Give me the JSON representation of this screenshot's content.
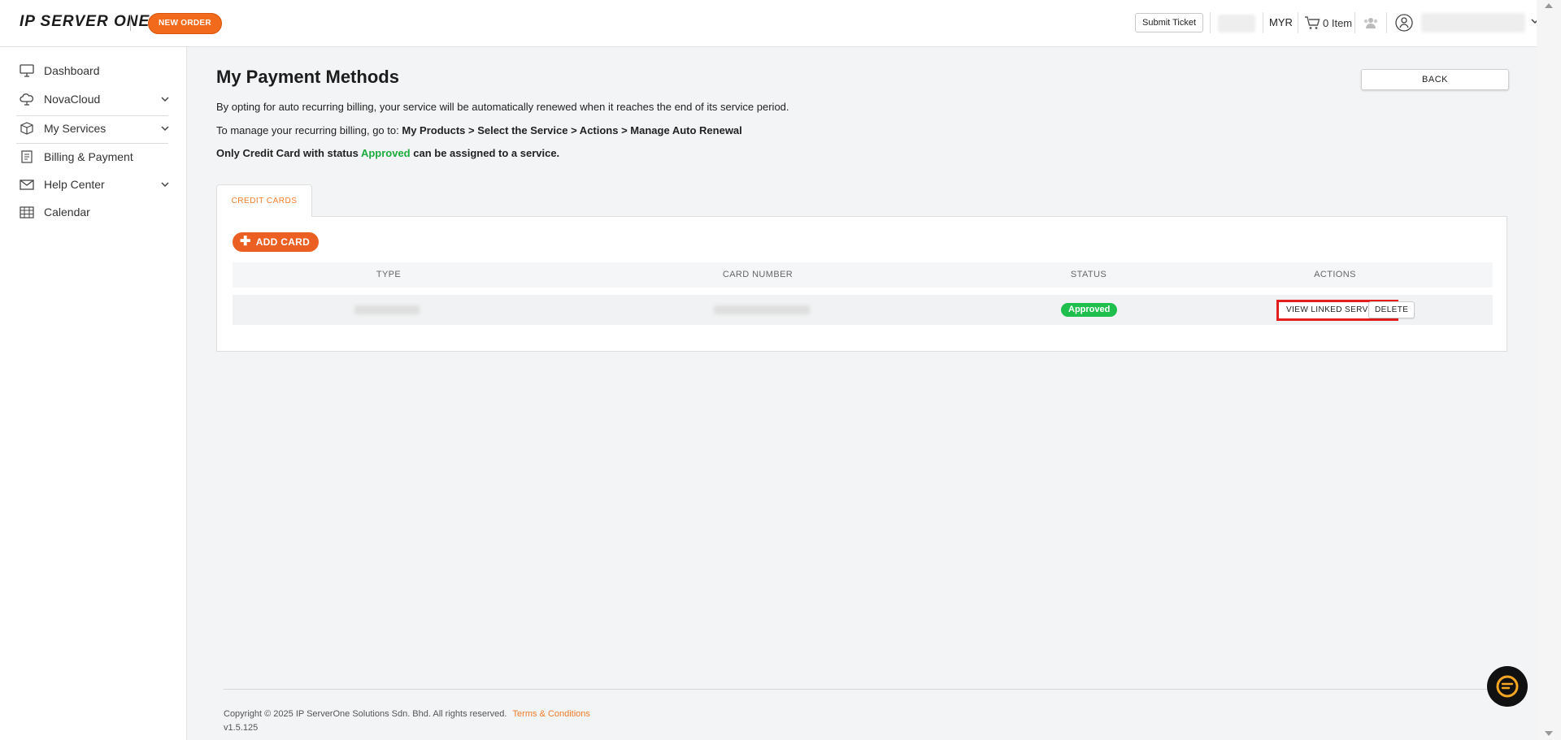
{
  "header": {
    "logo_text": "IP SERVER ONE",
    "new_order_label": "NEW ORDER",
    "submit_ticket_label": "Submit Ticket",
    "currency": "MYR",
    "cart_label": "0 Item"
  },
  "sidebar": {
    "items": [
      {
        "label": "Dashboard",
        "icon": "monitor-icon"
      },
      {
        "label": "NovaCloud",
        "icon": "cloud-icon"
      },
      {
        "label": "My Services",
        "icon": "box-icon"
      },
      {
        "label": "Billing & Payment",
        "icon": "invoice-icon"
      },
      {
        "label": "Help Center",
        "icon": "mail-icon"
      },
      {
        "label": "Calendar",
        "icon": "calendar-icon"
      }
    ]
  },
  "page": {
    "title": "My Payment Methods",
    "back_label": "BACK",
    "info_line1": "By opting for auto recurring billing, your service will be automatically renewed when it reaches the end of its service period.",
    "info_line2_prefix": "To manage your recurring billing, go to:",
    "info_line2_path": "My Products > Select the Service > Actions > Manage Auto Renewal",
    "info_line3_prefix": "Only Credit Card with status",
    "info_line3_status": "Approved",
    "info_line3_suffix": "can be assigned to a service."
  },
  "tabs": [
    {
      "label": "CREDIT CARDS",
      "active": true
    }
  ],
  "cards": {
    "add_card_label": "ADD CARD",
    "columns": [
      "TYPE",
      "CARD NUMBER",
      "STATUS",
      "ACTIONS"
    ],
    "rows": [
      {
        "status": "Approved",
        "view_linked_label": "VIEW LINKED SERVICES",
        "delete_label": "DELETE"
      }
    ]
  },
  "footer": {
    "copyright": "Copyright © 2025 IP ServerOne Solutions Sdn. Bhd. All rights reserved.",
    "terms_label": "Terms & Conditions",
    "version": "v1.5.125"
  },
  "colors": {
    "accent": "#f26a1b",
    "approved": "#1fbf4e",
    "highlight": "#e41d1d"
  }
}
